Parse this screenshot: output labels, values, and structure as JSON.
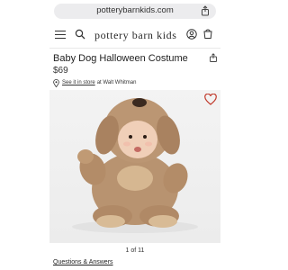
{
  "browser": {
    "url": "potterybarnkids.com",
    "share_icon": "share-icon"
  },
  "header": {
    "brand": "pottery barn kids",
    "menu_icon": "hamburger-menu-icon",
    "search_icon": "search-icon",
    "account_icon": "account-icon",
    "cart_icon": "cart-icon"
  },
  "product": {
    "title": "Baby Dog Halloween Costume",
    "price": "$69",
    "store_link": "See it in store",
    "store_suffix": "at Walt Whitman",
    "image_alt_icon": "product-photo",
    "image_counter": "1 of 11",
    "wishlist_color": "#c0392b"
  },
  "footer": {
    "qa_link": "Questions & Answers"
  }
}
